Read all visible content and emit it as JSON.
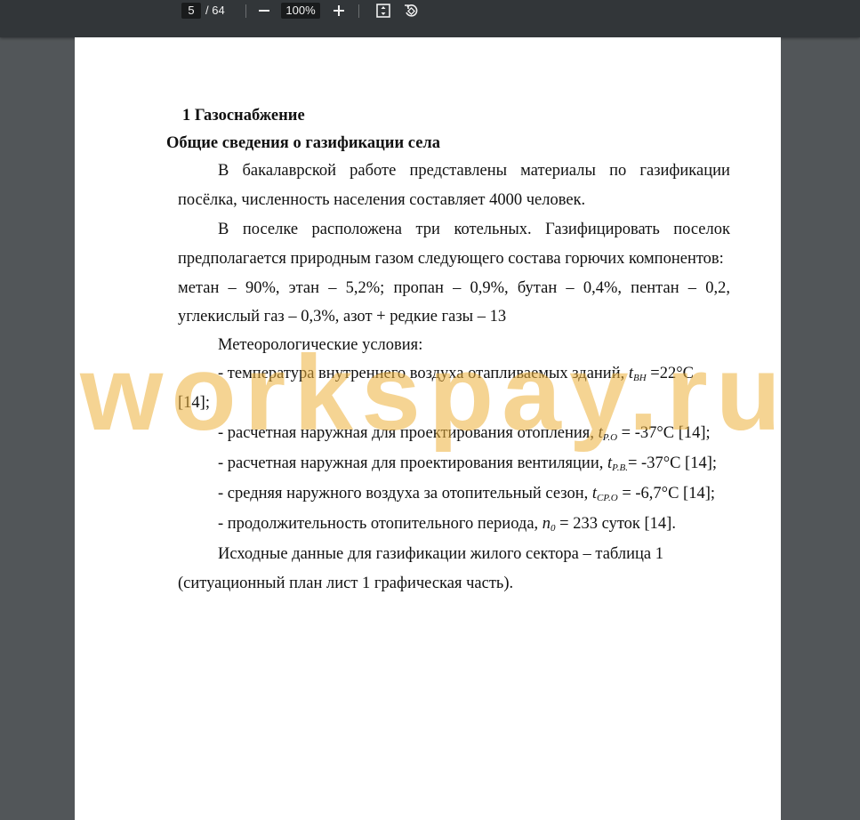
{
  "toolbar": {
    "current_page": "5",
    "total_pages": "/ 64",
    "zoom": "100%",
    "zoom_out_icon": "minus-icon",
    "zoom_in_icon": "plus-icon",
    "fit_icon": "fit-page-icon",
    "rotate_icon": "rotate-icon"
  },
  "document": {
    "heading": "1 Газоснабжение",
    "subheading": "Общие сведения о газификации села",
    "p1": {
      "line1": [
        "В",
        "бакалаврской",
        "работе",
        "представлены",
        "материалы",
        "по",
        "газификации"
      ],
      "line2": "посёлка, численность населения составляет 4000 человек."
    },
    "p2": {
      "line1": [
        "В",
        "поселке",
        "расположена",
        "три",
        "котельных.",
        "Газифицировать",
        "поселок"
      ],
      "line2": "предполагается природным газом следующего состава горючих компонентов:",
      "line3": [
        "метан",
        "–",
        "90%,",
        "этан",
        "–",
        "5,2%;",
        "пропан",
        "–",
        "0,9%,",
        "бутан",
        "–",
        "0,4%,",
        "пентан",
        "–",
        "0,2,"
      ],
      "line4": "углекислый газ – 0,3%, азот + редкие газы – 13"
    },
    "meteo_title": "Метеорологические условия:",
    "item1": {
      "text": "- температура внутреннего воздуха отапливаемых зданий,",
      "var": "t",
      "sub": "ВН",
      "value": " =22°С",
      "cont": "[14];"
    },
    "item2": {
      "text": "- расчетная наружная для проектирования отопления,",
      "var": "t",
      "sub": "Р.О",
      "value": " = -37°С [14];"
    },
    "item3": {
      "text": "- расчетная наружная для проектирования вентиляции,",
      "var": "t",
      "sub": "Р.В.",
      "value": "= -37°С [14];"
    },
    "item4": {
      "text": "- средняя наружного воздуха за отопительный сезон,",
      "var": "t",
      "sub": "СР.О",
      "value": " = -6,7°С [14];"
    },
    "item5": {
      "text": "- продолжительность отопительного периода,",
      "var": "n",
      "sub": "0",
      "value": " = 233 суток [14]."
    },
    "p3": {
      "line1": "Исходные данные для газификации жилого сектора – таблица 1",
      "line2": "(ситуационный план лист 1 графическая часть)."
    }
  },
  "watermark": "workspay.ru"
}
